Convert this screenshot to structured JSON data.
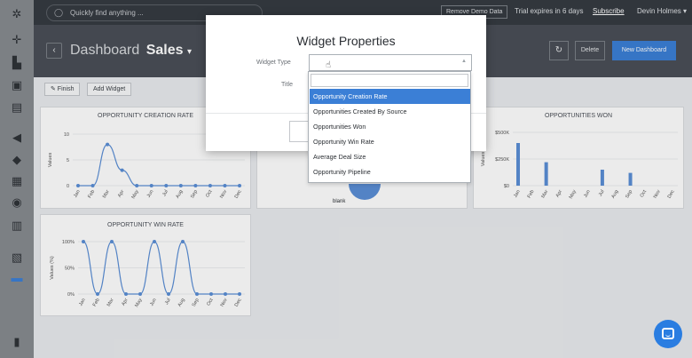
{
  "rail": {
    "icons": [
      "app-logo-icon",
      "compass-icon",
      "bar-chart-icon",
      "contacts-icon",
      "briefcase-icon",
      "megaphone-icon",
      "tag-icon",
      "printer-icon",
      "gauge-icon",
      "calendar-icon",
      "document-icon",
      "dashboard-icon",
      "book-icon"
    ]
  },
  "topbar": {
    "search_placeholder": "Quickly find anything ...",
    "remove_demo_label": "Remove Demo Data",
    "trial_text": "Trial expires in 6 days",
    "subscribe_label": "Subscribe",
    "user_name": "Devin Holmes",
    "user_caret": "▾"
  },
  "header": {
    "back_label": "‹",
    "title": "Dashboard",
    "name": "Sales",
    "name_caret": "▾",
    "refresh_label": "↻",
    "delete_label": "Delete",
    "new_dashboard_label": "New Dashboard"
  },
  "toolbar": {
    "finish_label": "✎  Finish",
    "add_widget_label": "Add Widget"
  },
  "modal": {
    "title": "Widget Properties",
    "widget_type_label": "Widget Type",
    "title_label": "Title",
    "dropdown_options": [
      "Opportunity Creation Rate",
      "Opportunities Created By Source",
      "Opportunities Won",
      "Opportunity Win Rate",
      "Average Deal Size",
      "Opportunity Pipeline"
    ],
    "selected_index": 0
  },
  "pie_blank_label": "blank",
  "chart_data": [
    {
      "type": "line",
      "title": "OPPORTUNITY CREATION RATE",
      "ylabel": "Values",
      "categories": [
        "Jan",
        "Feb",
        "Mar",
        "Apr",
        "May",
        "Jun",
        "Jul",
        "Aug",
        "Sep",
        "Oct",
        "Nov",
        "Dec"
      ],
      "values": [
        0,
        0,
        8,
        3,
        0,
        0,
        0,
        0,
        0,
        0,
        0,
        0
      ],
      "yticks": [
        "0",
        "5",
        "10"
      ],
      "ylim": [
        0,
        10
      ]
    },
    {
      "type": "bar",
      "title": "OPPORTUNITIES WON",
      "ylabel": "Values",
      "categories": [
        "Jan",
        "Feb",
        "Mar",
        "Apr",
        "May",
        "Jun",
        "Jul",
        "Aug",
        "Sep",
        "Oct",
        "Nov",
        "Dec"
      ],
      "values": [
        400000,
        0,
        220000,
        0,
        0,
        0,
        150000,
        0,
        120000,
        0,
        0,
        0
      ],
      "yticks": [
        "$0",
        "$250K",
        "$500K"
      ],
      "ylim": [
        0,
        500000
      ]
    },
    {
      "type": "line",
      "title": "OPPORTUNITY WIN RATE",
      "ylabel": "Values (%)",
      "categories": [
        "Jan",
        "Feb",
        "Mar",
        "Apr",
        "May",
        "Jun",
        "Jul",
        "Aug",
        "Sep",
        "Oct",
        "Nov",
        "Dec"
      ],
      "values": [
        100,
        0,
        100,
        0,
        0,
        100,
        0,
        100,
        0,
        0,
        0,
        0
      ],
      "yticks": [
        "0%",
        "50%",
        "100%"
      ],
      "ylim": [
        0,
        100
      ]
    }
  ]
}
